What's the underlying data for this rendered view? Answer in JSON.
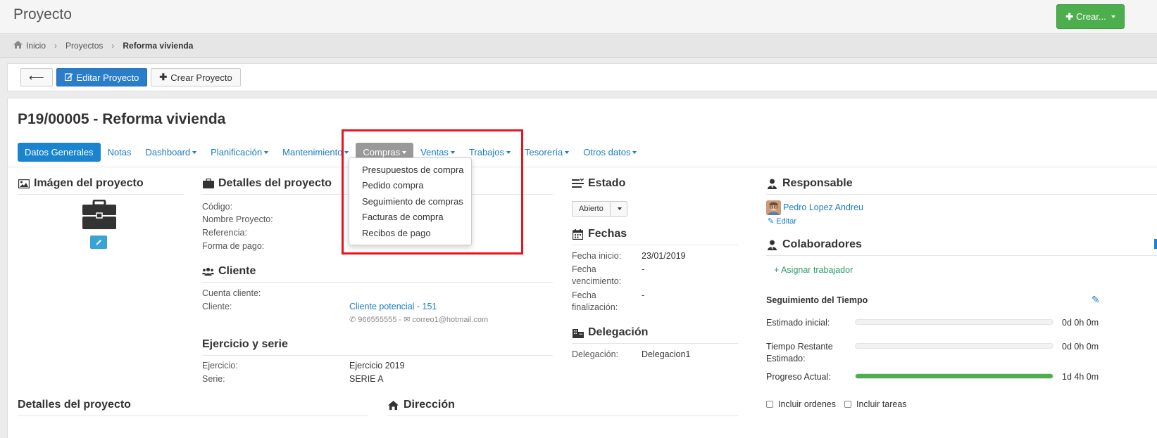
{
  "header": {
    "title": "Proyecto",
    "crear_label": "Crear..."
  },
  "breadcrumb": {
    "home": "Inicio",
    "projects": "Proyectos",
    "current": "Reforma vivienda"
  },
  "toolbar": {
    "edit_label": "Editar Proyecto",
    "create_label": "Crear Proyecto"
  },
  "project": {
    "title": "P19/00005 - Reforma vivienda"
  },
  "tabs": [
    {
      "label": "Datos Generales"
    },
    {
      "label": "Notas"
    },
    {
      "label": "Dashboard"
    },
    {
      "label": "Planificación"
    },
    {
      "label": "Mantenimiento"
    },
    {
      "label": "Compras"
    },
    {
      "label": "Ventas"
    },
    {
      "label": "Trabajos"
    },
    {
      "label": "Tesorería"
    },
    {
      "label": "Otros datos"
    }
  ],
  "compras_menu": [
    "Presupuestos de compra",
    "Pedido compra",
    "Seguimiento de compras",
    "Facturas de compra",
    "Recibos de pago"
  ],
  "imagen": {
    "heading": "Imágen del proyecto"
  },
  "detalles": {
    "heading": "Detalles del proyecto",
    "codigo": "Código:",
    "nombre": "Nombre Proyecto:",
    "referencia": "Referencia:",
    "forma_pago": "Forma de pago:"
  },
  "cliente": {
    "heading": "Cliente",
    "cuenta_label": "Cuenta cliente:",
    "cliente_label": "Cliente:",
    "cliente_value": "Cliente potencial - 151",
    "phone": "966555555",
    "email": "correo1@hotmail.com"
  },
  "ejercicio": {
    "heading": "Ejercicio y serie",
    "ejercicio_label": "Ejercicio:",
    "ejercicio_value": "Ejercicio 2019",
    "serie_label": "Serie:",
    "serie_value": "SERIE A"
  },
  "estado": {
    "heading": "Estado",
    "value": "Abierto"
  },
  "fechas": {
    "heading": "Fechas",
    "inicio_label": "Fecha inicio:",
    "inicio_value": "23/01/2019",
    "venc_label_1": "Fecha",
    "venc_label_2": "vencimiento:",
    "venc_value": "-",
    "fin_label_1": "Fecha",
    "fin_label_2": "finalización:",
    "fin_value": "-"
  },
  "delegacion": {
    "heading": "Delegación",
    "label": "Delegación:",
    "value": "Delegacion1"
  },
  "responsable": {
    "heading": "Responsable",
    "name": "Pedro Lopez Andreu",
    "edit": "Editar"
  },
  "colaboradores": {
    "heading": "Colaboradores",
    "assign": "+ Asignar trabajador"
  },
  "tiempo": {
    "heading": "Seguimiento del Tiempo",
    "estimado_label": "Estimado inicial:",
    "estimado_value": "0d 0h 0m",
    "restante_label_1": "Tiempo Restante",
    "restante_label_2": "Estimado:",
    "restante_value": "0d 0h 0m",
    "progreso_label": "Progreso Actual:",
    "progreso_value": "1d 4h 0m",
    "progress_fraction": 1.0,
    "incluir_ordenes": "Incluir ordenes",
    "incluir_tareas": "Incluir tareas"
  },
  "bottom": {
    "detalles_heading": "Detalles del proyecto",
    "direccion_heading": "Dirección"
  },
  "colors": {
    "primary": "#1a84ce",
    "success": "#4cae4c",
    "highlight": "#e8141c"
  }
}
